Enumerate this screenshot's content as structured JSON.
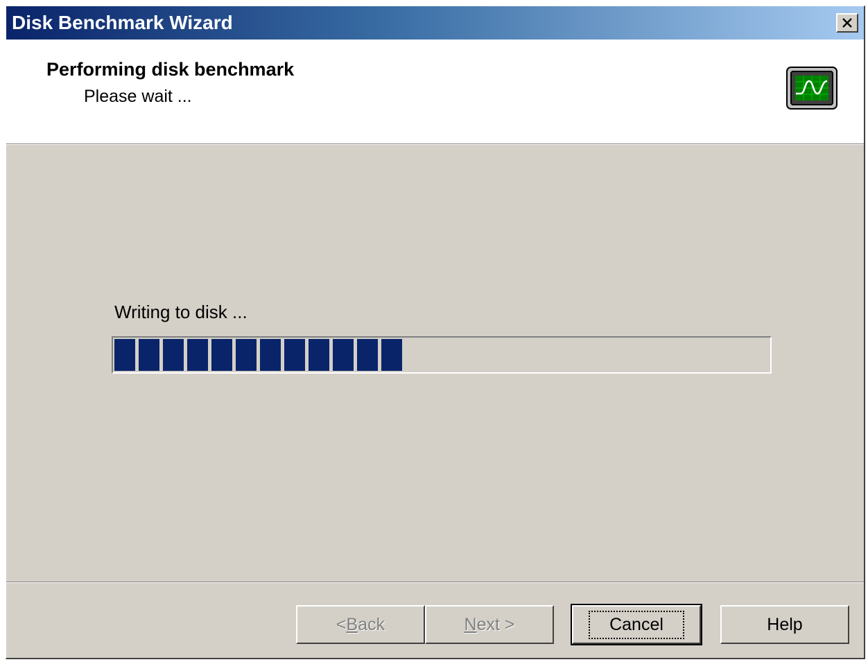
{
  "window": {
    "title": "Disk Benchmark Wizard"
  },
  "header": {
    "title": "Performing disk benchmark",
    "subtitle": "Please wait ...",
    "icon": "monitor-waveform-icon"
  },
  "main": {
    "status_text": "Writing to disk ...",
    "progress": {
      "percent": 44
    }
  },
  "buttons": {
    "back_prefix": "< ",
    "back_mnemonic": "B",
    "back_suffix": "ack",
    "next_mnemonic": "N",
    "next_suffix": "ext >",
    "cancel": "Cancel",
    "help": "Help"
  },
  "colors": {
    "title_start": "#0a246a",
    "title_end": "#a6caf0",
    "progress_fill": "#0a246a",
    "dialog_bg": "#d4d0c8"
  }
}
